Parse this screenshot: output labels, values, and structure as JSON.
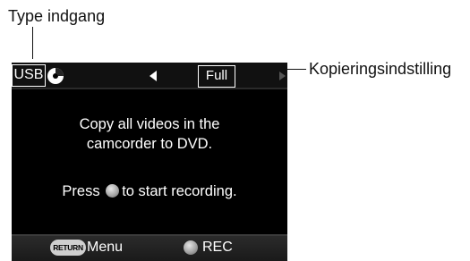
{
  "callouts": {
    "input_type": "Type indgang",
    "copy_setting": "Kopieringsindstilling"
  },
  "screen": {
    "topbar": {
      "input_label": "USB",
      "mode_label": "Full"
    },
    "message": {
      "line1": "Copy all videos in the",
      "line2": "camcorder to DVD.",
      "press_before": "Press",
      "press_after": "to start recording."
    },
    "bottombar": {
      "return_button": "RETURN",
      "menu_label": "Menu",
      "rec_label": "REC"
    }
  },
  "icons": {
    "disc": "disc-icon",
    "left": "triangle-left-icon",
    "right": "triangle-right-icon",
    "center_button": "center-button-icon"
  }
}
